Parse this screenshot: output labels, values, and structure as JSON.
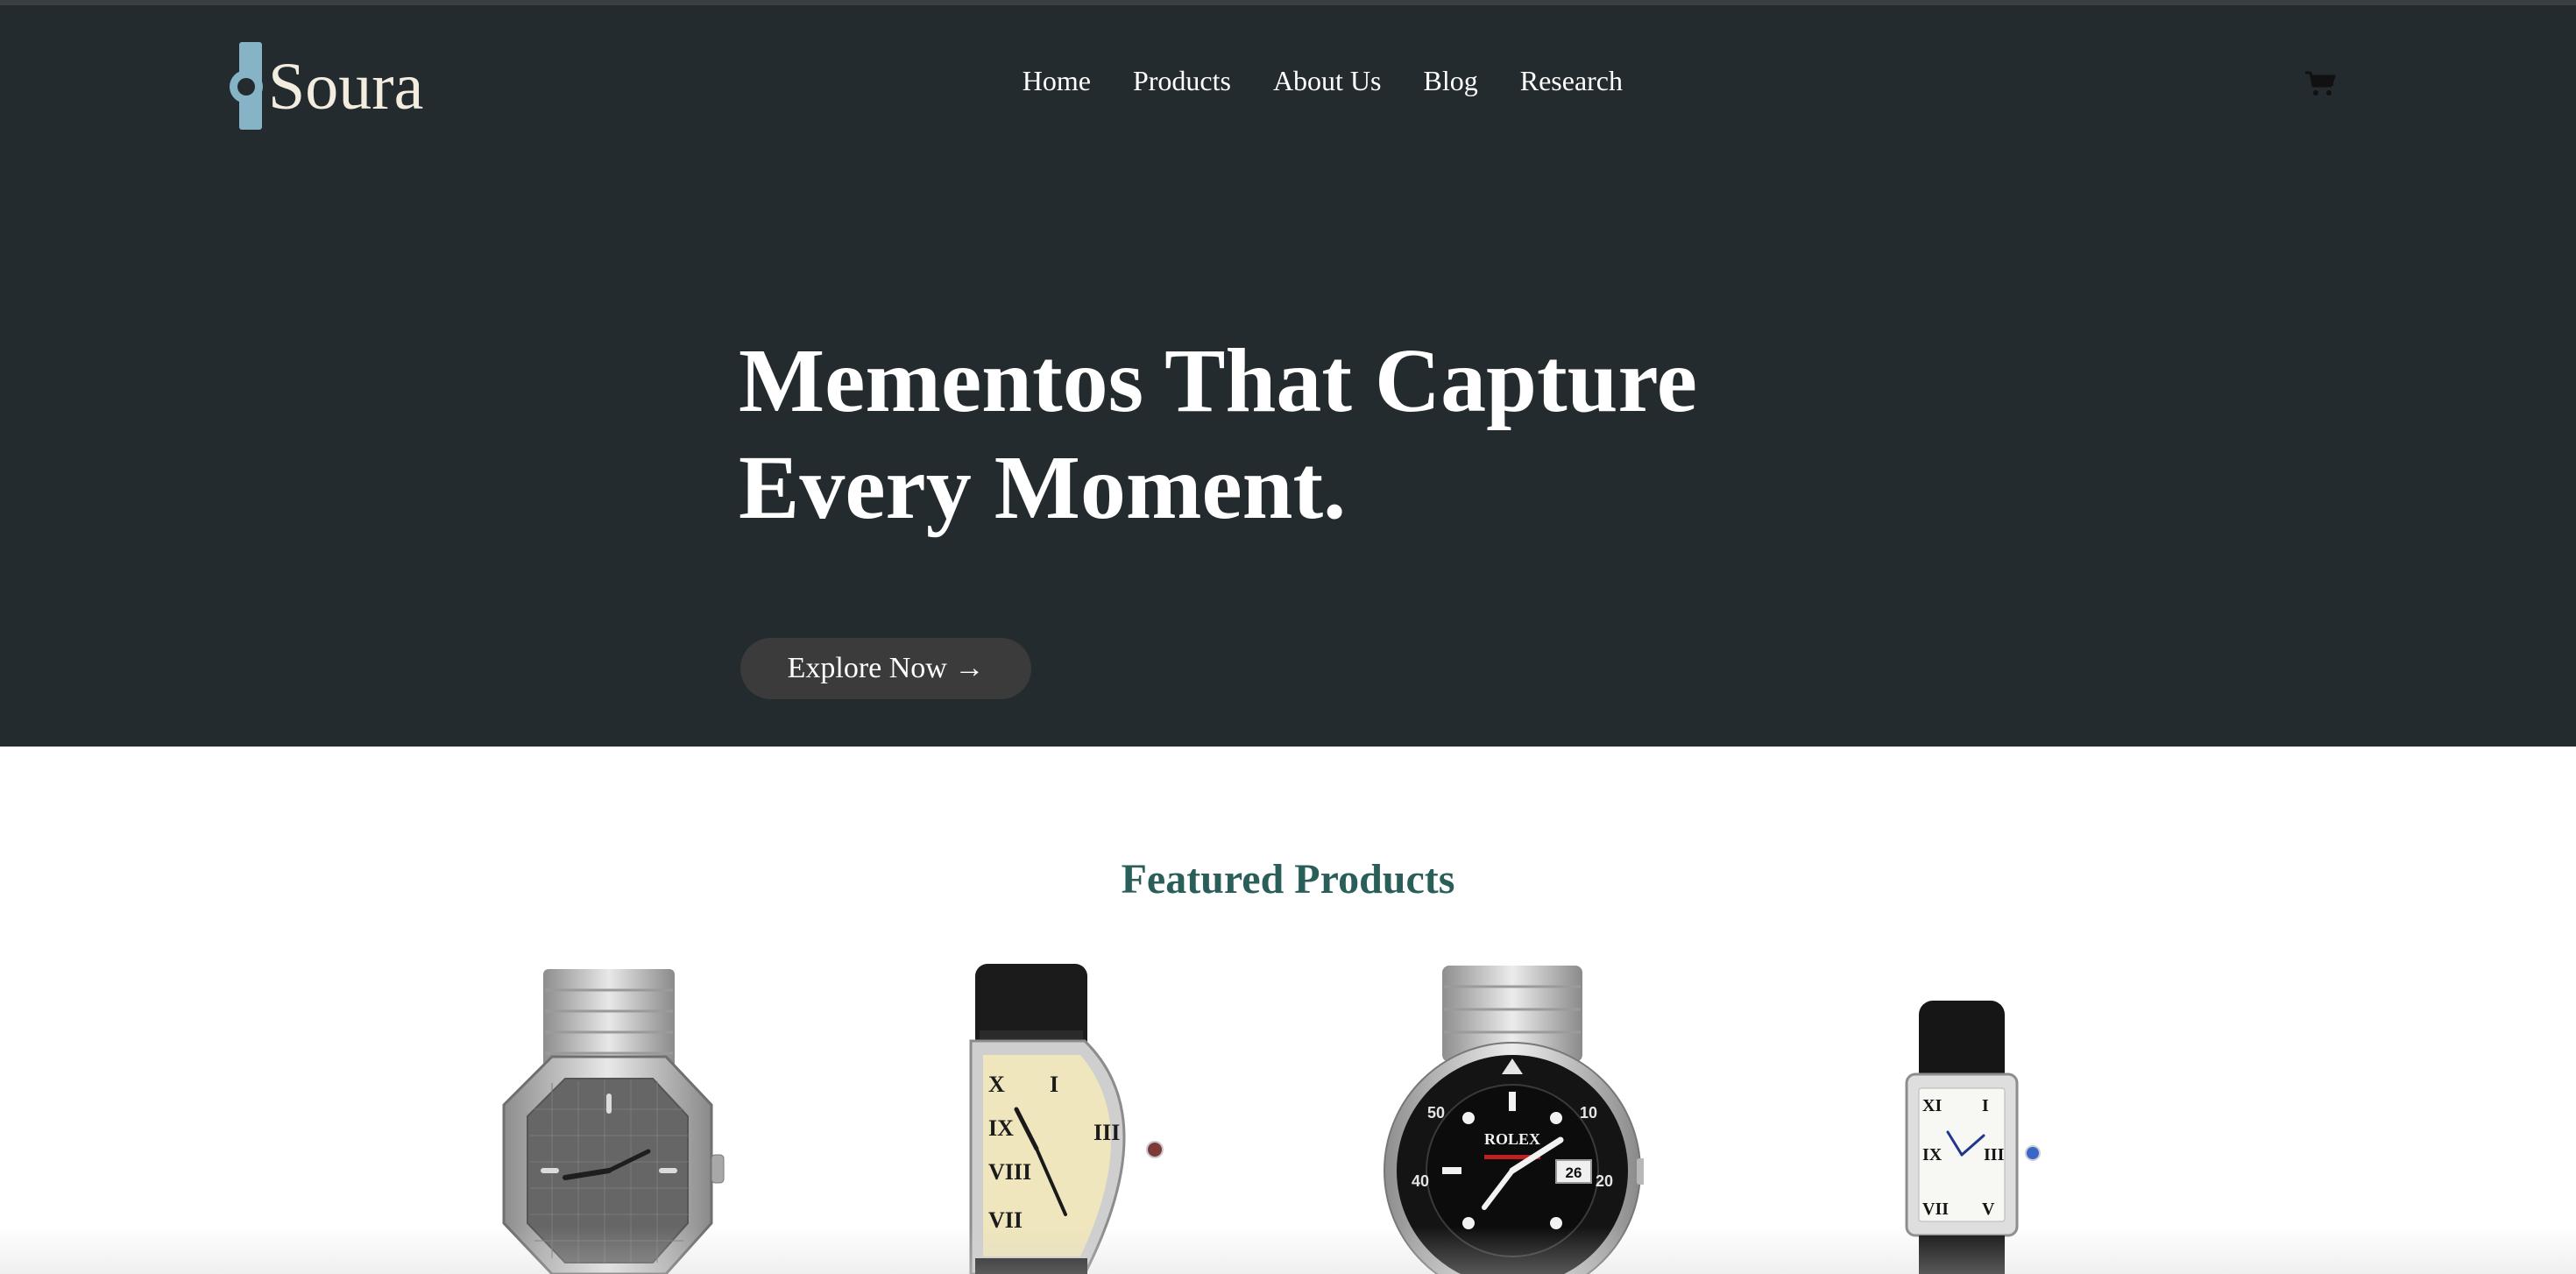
{
  "brand": {
    "name": "Soura",
    "accent": "#86b3c6",
    "logo_text_color": "#f3ede0"
  },
  "nav": {
    "items": [
      {
        "label": "Home"
      },
      {
        "label": "Products"
      },
      {
        "label": "About Us"
      },
      {
        "label": "Blog"
      },
      {
        "label": "Research"
      }
    ],
    "cart_icon": "cart-icon"
  },
  "hero": {
    "title_line1": "Mementos That Capture",
    "title_line2": "Every Moment.",
    "cta_label": "Explore Now →",
    "background": "#242b2e"
  },
  "featured": {
    "title": "Featured Products",
    "title_color": "#2a5e58",
    "products": [
      {
        "image": "silver-octagonal-bracelet-watch"
      },
      {
        "image": "cream-dial-leather-strap-watch"
      },
      {
        "image": "black-bezel-diver-watch"
      },
      {
        "image": "rectangular-white-dial-watch"
      }
    ]
  }
}
